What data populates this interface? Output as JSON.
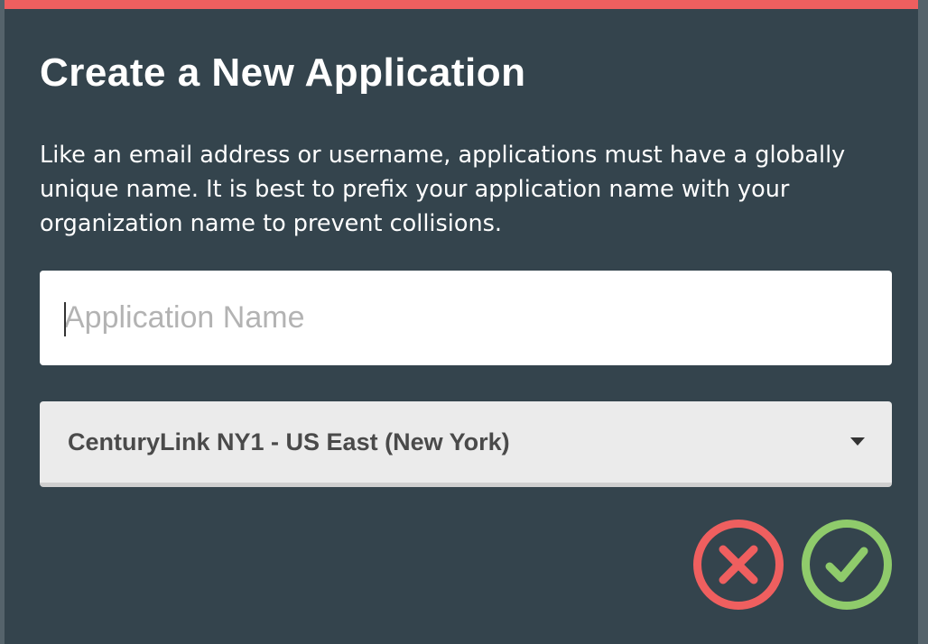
{
  "dialog": {
    "title": "Create a New Application",
    "description": "Like an email address or username, applications must have a globally unique name. It is best to prefix your application name with your organization name to prevent collisions.",
    "name_field": {
      "value": "",
      "placeholder": "Application Name"
    },
    "region_select": {
      "selected": "CenturyLink NY1 - US East (New York)"
    },
    "actions": {
      "cancel_icon": "close-icon",
      "confirm_icon": "checkmark-icon"
    }
  },
  "colors": {
    "accent_red": "#ef5f5f",
    "accent_green": "#8fcb6b",
    "modal_bg": "#34444d"
  }
}
